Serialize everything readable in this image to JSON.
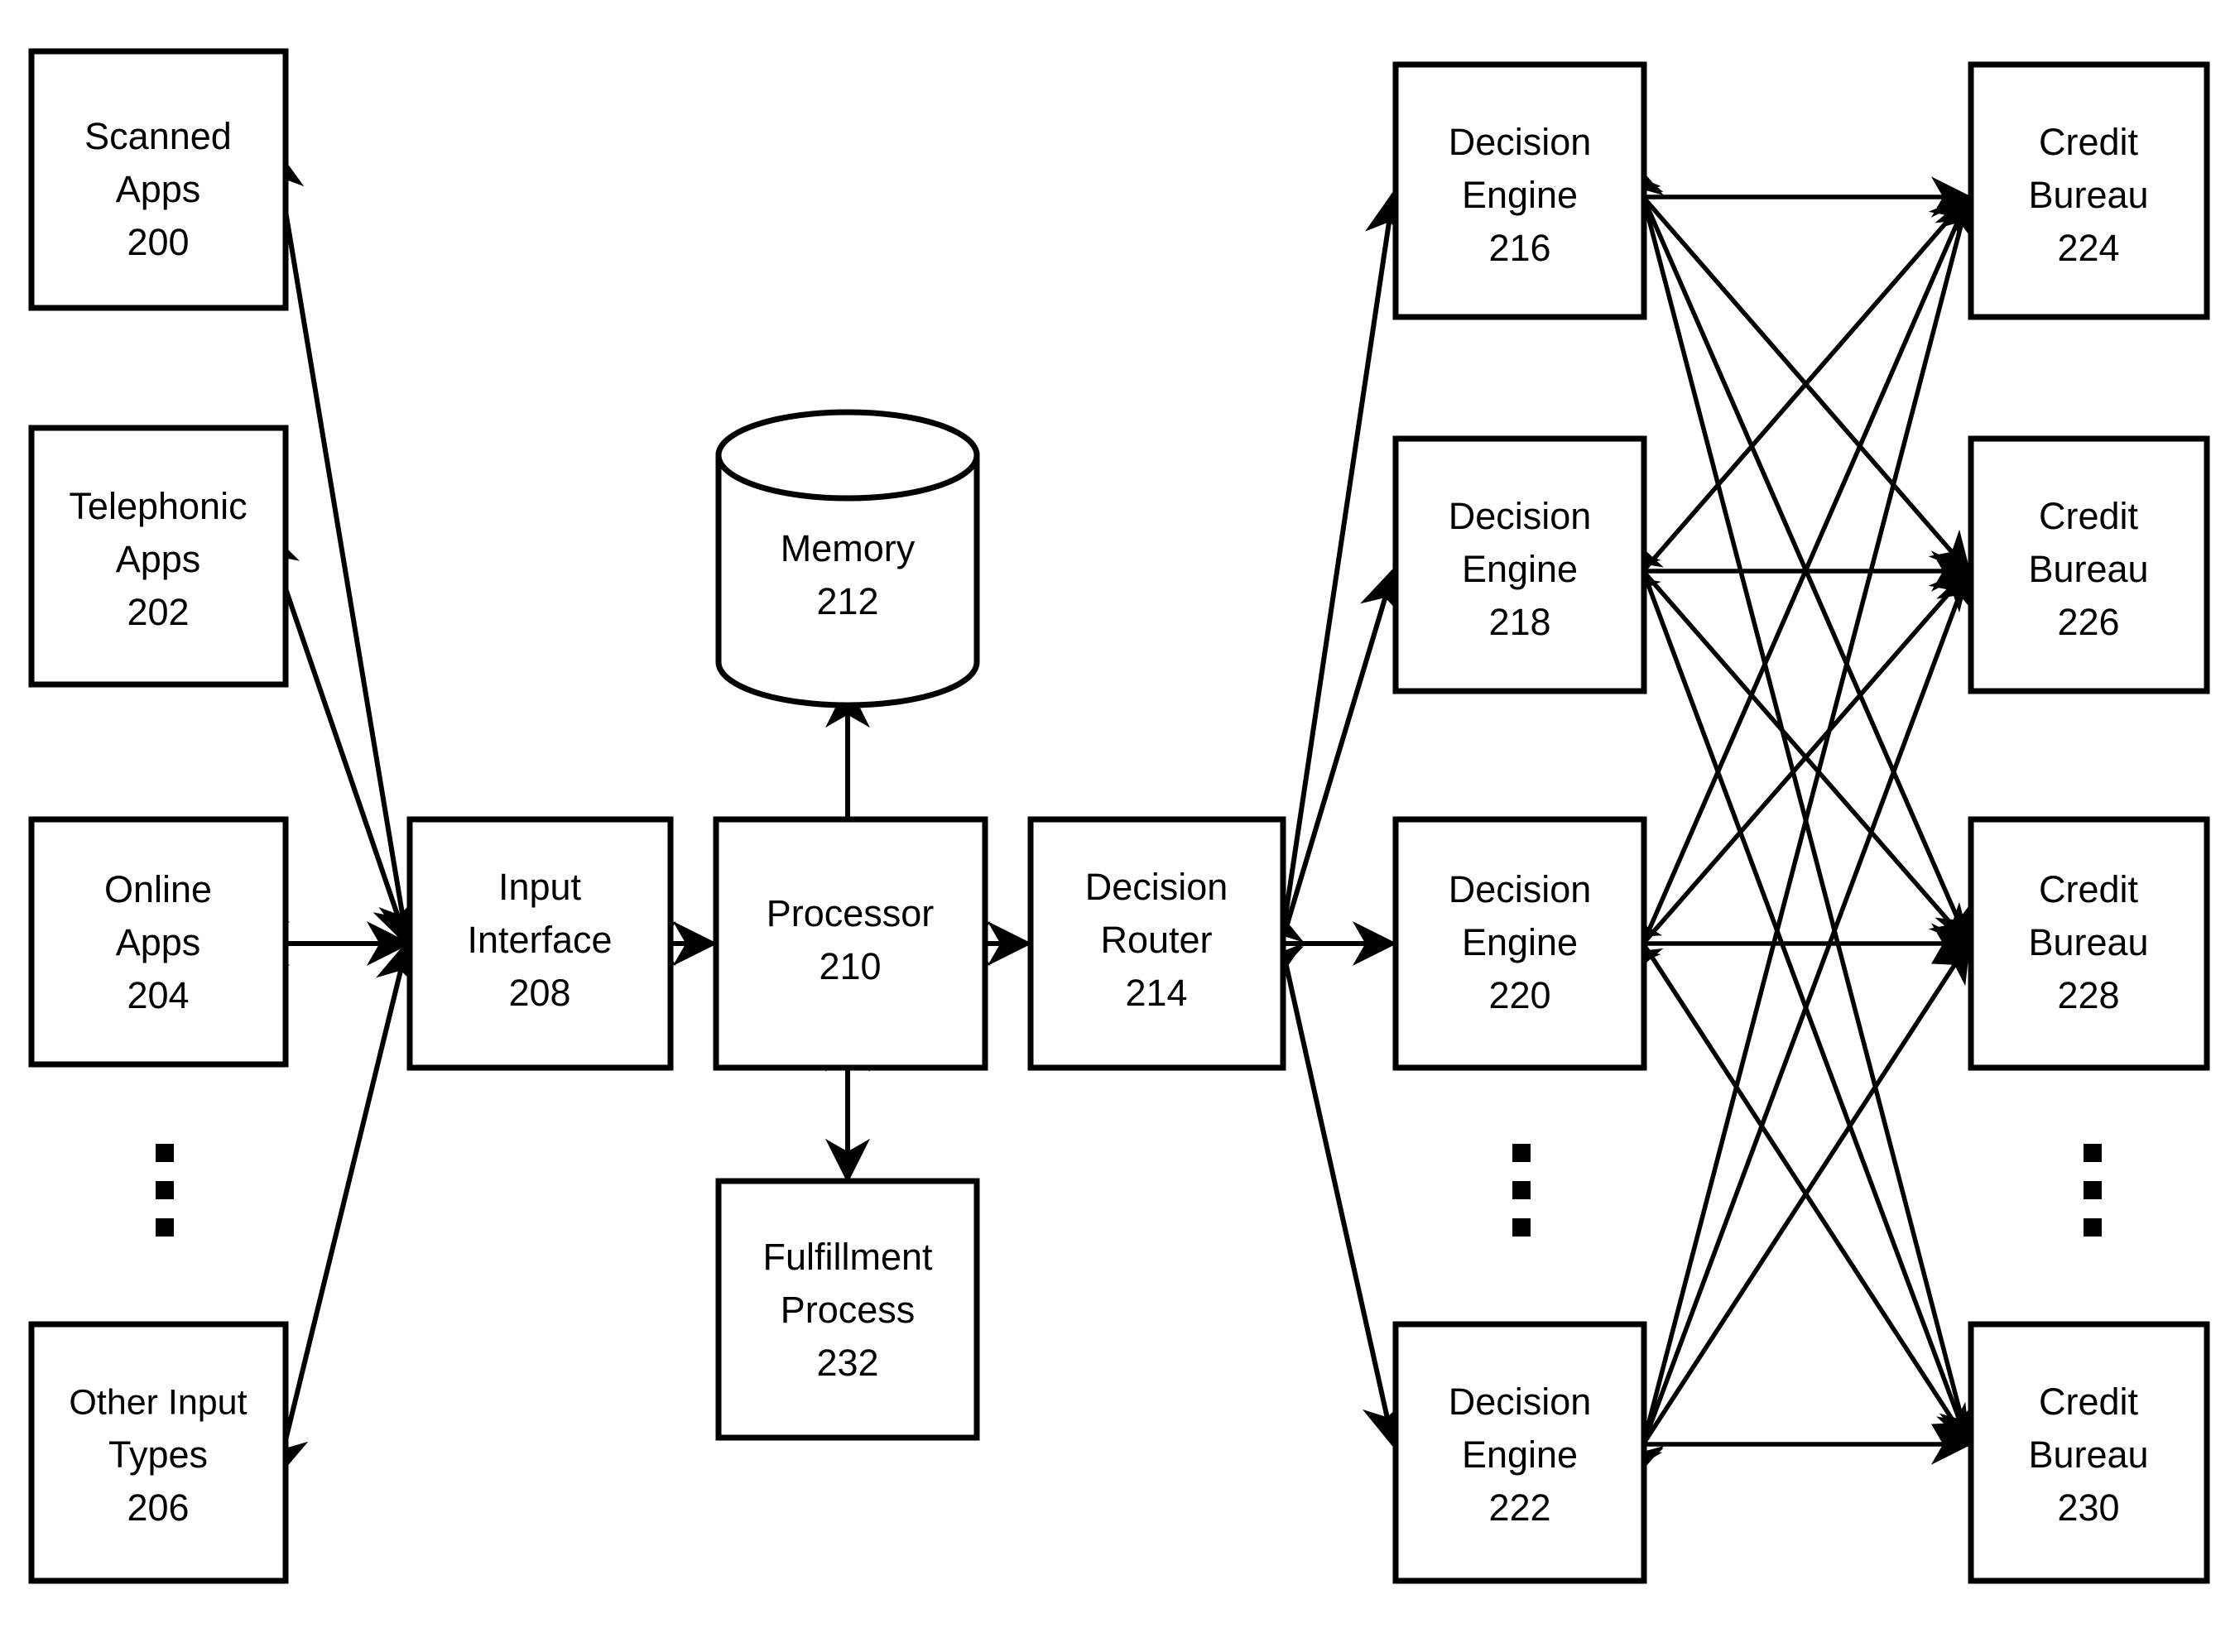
{
  "figure": {
    "type": "patent-system-block-diagram",
    "background_color": "#ffffff",
    "line_color": "#000000"
  },
  "nodes": {
    "inputs": [
      {
        "id": "scanned-apps",
        "line1": "Scanned",
        "line2": "Apps",
        "ref": "200"
      },
      {
        "id": "telephonic-apps",
        "line1": "Telephonic",
        "line2": "Apps",
        "ref": "202"
      },
      {
        "id": "online-apps",
        "line1": "Online",
        "line2": "Apps",
        "ref": "204"
      },
      {
        "id": "other-input-types",
        "line1": "Other Input",
        "line2": "Types",
        "ref": "206"
      }
    ],
    "core": [
      {
        "id": "input-interface",
        "line1": "Input",
        "line2": "Interface",
        "ref": "208"
      },
      {
        "id": "processor",
        "line1": "Processor",
        "line2": "",
        "ref": "210"
      },
      {
        "id": "memory",
        "line1": "Memory",
        "line2": "",
        "ref": "212"
      },
      {
        "id": "decision-router",
        "line1": "Decision",
        "line2": "Router",
        "ref": "214"
      },
      {
        "id": "fulfillment-process",
        "line1": "Fulfillment",
        "line2": "Process",
        "ref": "232"
      }
    ],
    "decision_engines": [
      {
        "id": "decision-engine-216",
        "line1": "Decision",
        "line2": "Engine",
        "ref": "216"
      },
      {
        "id": "decision-engine-218",
        "line1": "Decision",
        "line2": "Engine",
        "ref": "218"
      },
      {
        "id": "decision-engine-220",
        "line1": "Decision",
        "line2": "Engine",
        "ref": "220"
      },
      {
        "id": "decision-engine-222",
        "line1": "Decision",
        "line2": "Engine",
        "ref": "222"
      }
    ],
    "credit_bureaus": [
      {
        "id": "credit-bureau-224",
        "line1": "Credit",
        "line2": "Bureau",
        "ref": "224"
      },
      {
        "id": "credit-bureau-226",
        "line1": "Credit",
        "line2": "Bureau",
        "ref": "226"
      },
      {
        "id": "credit-bureau-228",
        "line1": "Credit",
        "line2": "Bureau",
        "ref": "228"
      },
      {
        "id": "credit-bureau-230",
        "line1": "Credit",
        "line2": "Bureau",
        "ref": "230"
      }
    ]
  },
  "ellipses": [
    {
      "id": "inputs-ellipsis",
      "dots": 3
    },
    {
      "id": "decision-engines-ellipsis",
      "dots": 3
    },
    {
      "id": "credit-bureaus-ellipsis",
      "dots": 3
    }
  ],
  "connections": [
    {
      "from": "scanned-apps",
      "to": "input-interface",
      "arrow": "both"
    },
    {
      "from": "telephonic-apps",
      "to": "input-interface",
      "arrow": "both"
    },
    {
      "from": "online-apps",
      "to": "input-interface",
      "arrow": "both"
    },
    {
      "from": "other-input-types",
      "to": "input-interface",
      "arrow": "both"
    },
    {
      "from": "input-interface",
      "to": "processor",
      "arrow": "both"
    },
    {
      "from": "processor",
      "to": "memory",
      "arrow": "both"
    },
    {
      "from": "processor",
      "to": "decision-router",
      "arrow": "both"
    },
    {
      "from": "processor",
      "to": "fulfillment-process",
      "arrow": "both"
    },
    {
      "from": "decision-router",
      "to": "decision-engine-216",
      "arrow": "both"
    },
    {
      "from": "decision-router",
      "to": "decision-engine-218",
      "arrow": "both"
    },
    {
      "from": "decision-router",
      "to": "decision-engine-220",
      "arrow": "both"
    },
    {
      "from": "decision-router",
      "to": "decision-engine-222",
      "arrow": "both"
    },
    {
      "from": "decision-engine-216",
      "to": "credit-bureau-224",
      "arrow": "both"
    },
    {
      "from": "decision-engine-216",
      "to": "credit-bureau-226",
      "arrow": "both"
    },
    {
      "from": "decision-engine-216",
      "to": "credit-bureau-228",
      "arrow": "both"
    },
    {
      "from": "decision-engine-216",
      "to": "credit-bureau-230",
      "arrow": "both"
    },
    {
      "from": "decision-engine-218",
      "to": "credit-bureau-224",
      "arrow": "both"
    },
    {
      "from": "decision-engine-218",
      "to": "credit-bureau-226",
      "arrow": "both"
    },
    {
      "from": "decision-engine-218",
      "to": "credit-bureau-228",
      "arrow": "both"
    },
    {
      "from": "decision-engine-218",
      "to": "credit-bureau-230",
      "arrow": "both"
    },
    {
      "from": "decision-engine-220",
      "to": "credit-bureau-224",
      "arrow": "both"
    },
    {
      "from": "decision-engine-220",
      "to": "credit-bureau-226",
      "arrow": "both"
    },
    {
      "from": "decision-engine-220",
      "to": "credit-bureau-228",
      "arrow": "both"
    },
    {
      "from": "decision-engine-220",
      "to": "credit-bureau-230",
      "arrow": "both"
    },
    {
      "from": "decision-engine-222",
      "to": "credit-bureau-224",
      "arrow": "both"
    },
    {
      "from": "decision-engine-222",
      "to": "credit-bureau-226",
      "arrow": "both"
    },
    {
      "from": "decision-engine-222",
      "to": "credit-bureau-228",
      "arrow": "both"
    },
    {
      "from": "decision-engine-222",
      "to": "credit-bureau-230",
      "arrow": "both"
    }
  ]
}
